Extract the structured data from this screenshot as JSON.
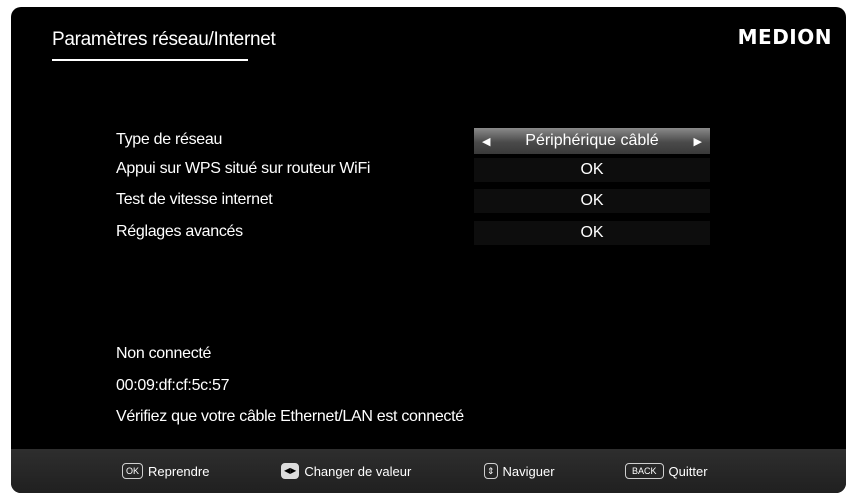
{
  "header": {
    "title": "Paramètres réseau/Internet",
    "brand": "MEDION"
  },
  "settings": {
    "network_type": {
      "label": "Type de réseau",
      "value": "Périphérique câblé"
    },
    "wps": {
      "label": "Appui sur WPS situé sur routeur WiFi",
      "value": "OK"
    },
    "speed_test": {
      "label": "Test de vitesse internet",
      "value": "OK"
    },
    "advanced": {
      "label": "Réglages avancés",
      "value": "OK"
    }
  },
  "status": {
    "connection": "Non connecté",
    "mac": "00:09:df:cf:5c:57",
    "hint": "Vérifiez que votre câble Ethernet/LAN est connecté"
  },
  "footer": {
    "ok_key": "OK",
    "ok_label": "Reprendre",
    "change_label": "Changer de valeur",
    "nav_label": "Naviguer",
    "back_key": "BACK",
    "back_label": "Quitter"
  },
  "icons": [
    "left-arrow-icon",
    "right-arrow-icon",
    "ok-key-icon",
    "left-right-key-icon",
    "up-down-key-icon",
    "back-key-icon"
  ]
}
